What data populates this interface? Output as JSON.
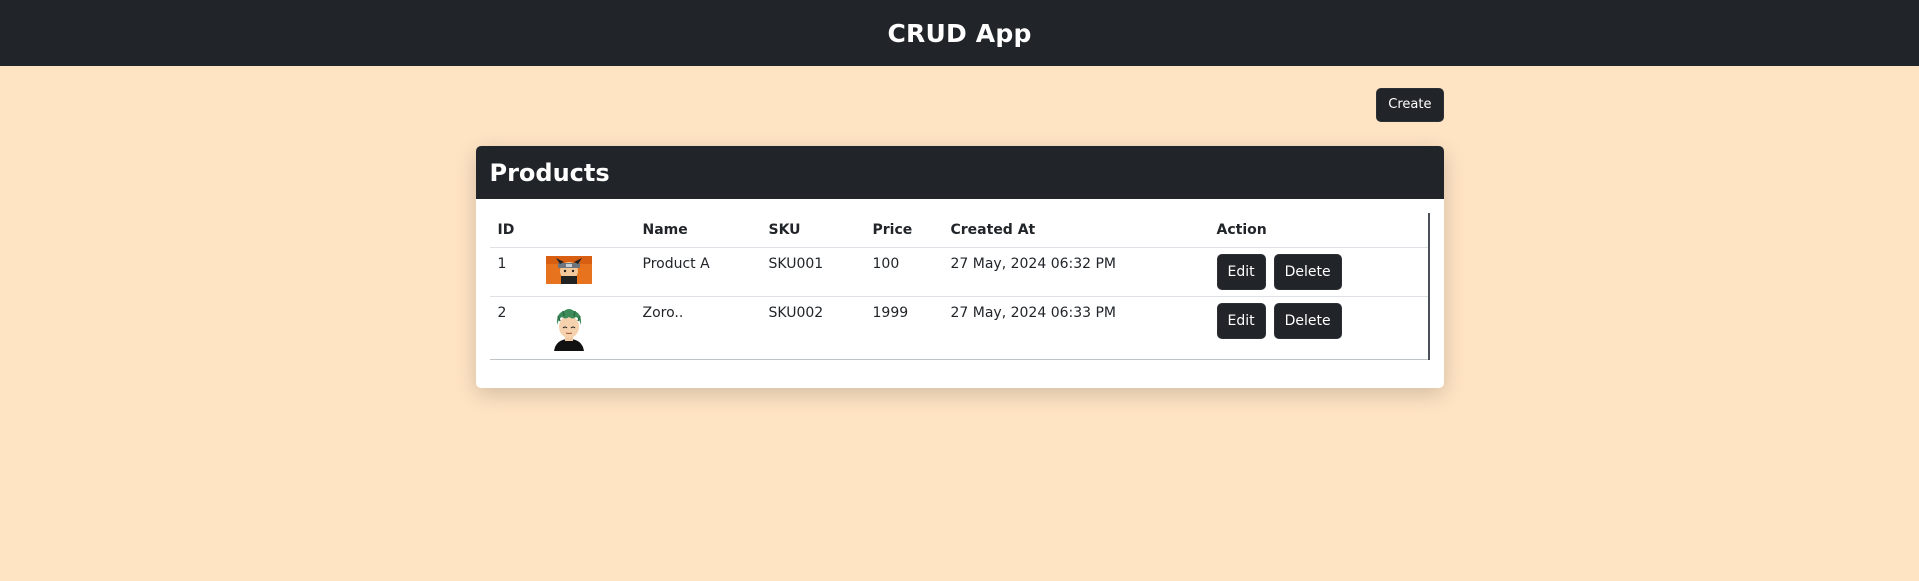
{
  "navbar": {
    "title": "CRUD App"
  },
  "toolbar": {
    "create_label": "Create"
  },
  "card": {
    "title": "Products"
  },
  "table": {
    "headers": [
      "ID",
      "",
      "Name",
      "SKU",
      "Price",
      "Created At",
      "Action"
    ],
    "rows": [
      {
        "id": "1",
        "image": "orange-ninja-thumbnail",
        "name": "Product A",
        "sku": "SKU001",
        "price": "100",
        "created_at": "27 May, 2024 06:32 PM",
        "edit_label": "Edit",
        "delete_label": "Delete"
      },
      {
        "id": "2",
        "image": "green-hair-avatar-thumbnail",
        "name": "Zoro..",
        "sku": "SKU002",
        "price": "1999",
        "created_at": "27 May, 2024 06:33 PM",
        "edit_label": "Edit",
        "delete_label": "Delete"
      }
    ]
  },
  "colors": {
    "dark": "#212529",
    "background": "#ffe4c4"
  }
}
